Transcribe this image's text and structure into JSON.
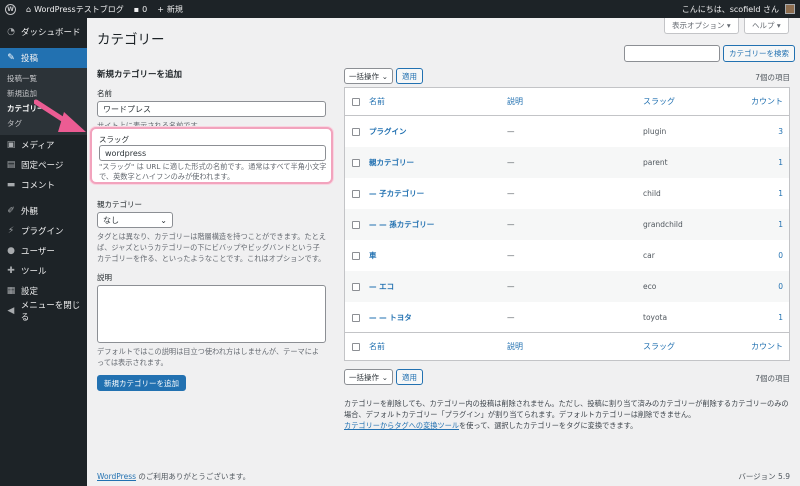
{
  "adminbar": {
    "site_name": "WordPressテストブログ",
    "comments_count": "0",
    "new_label": "新規",
    "greeting": "こんにちは、scofield さん"
  },
  "sidebar": {
    "items": [
      {
        "label": "ダッシュボード",
        "icon": "dashboard-icon"
      },
      {
        "label": "投稿",
        "icon": "pin-icon"
      },
      {
        "label": "メディア",
        "icon": "media-icon"
      },
      {
        "label": "固定ページ",
        "icon": "page-icon"
      },
      {
        "label": "コメント",
        "icon": "comment-icon"
      },
      {
        "label": "外観",
        "icon": "brush-icon"
      },
      {
        "label": "プラグイン",
        "icon": "plugin-icon"
      },
      {
        "label": "ユーザー",
        "icon": "user-icon"
      },
      {
        "label": "ツール",
        "icon": "wrench-icon"
      },
      {
        "label": "設定",
        "icon": "settings-icon"
      },
      {
        "label": "メニューを閉じる",
        "icon": "collapse-icon"
      }
    ],
    "submenu": [
      "投稿一覧",
      "新規追加",
      "カテゴリー",
      "タグ"
    ]
  },
  "top": {
    "screen_options": "表示オプション ▾",
    "help": "ヘルプ ▾"
  },
  "page_title": "カテゴリー",
  "search": {
    "button": "カテゴリーを検索",
    "value": ""
  },
  "form": {
    "heading": "新規カテゴリーを追加",
    "name_label": "名前",
    "name_value": "ワードプレス",
    "name_help": "サイト上に表示される名前です。",
    "slug_label": "スラッグ",
    "slug_value": "wordpress",
    "slug_help": "\"スラッグ\" は URL に適した形式の名前です。通常はすべて半角小文字で、英数字とハイフンのみが使われます。",
    "parent_label": "親カテゴリー",
    "parent_value": "なし",
    "parent_help": "タグとは異なり、カテゴリーは階層構造を持つことができます。たとえば、ジャズというカテゴリーの下にビバップやビッグバンドという子カテゴリーを作る、といったようなことです。これはオプションです。",
    "desc_label": "説明",
    "desc_help": "デフォルトではこの説明は目立つ使われ方はしませんが、テーマによっては表示されます。",
    "submit": "新規カテゴリーを追加"
  },
  "table": {
    "bulk_label": "一括操作",
    "apply": "適用",
    "count_text": "7個の項目",
    "headers": {
      "name": "名前",
      "desc": "説明",
      "slug": "スラッグ",
      "count": "カウント"
    },
    "rows": [
      {
        "name": "プラグイン",
        "desc": "—",
        "slug": "plugin",
        "count": "3"
      },
      {
        "name": "親カテゴリー",
        "desc": "—",
        "slug": "parent",
        "count": "1"
      },
      {
        "name": "— 子カテゴリー",
        "desc": "—",
        "slug": "child",
        "count": "1"
      },
      {
        "name": "— — 孫カテゴリー",
        "desc": "—",
        "slug": "grandchild",
        "count": "1"
      },
      {
        "name": "車",
        "desc": "—",
        "slug": "car",
        "count": "0"
      },
      {
        "name": "— エコ",
        "desc": "—",
        "slug": "eco",
        "count": "0"
      },
      {
        "name": "— — トヨタ",
        "desc": "—",
        "slug": "toyota",
        "count": "1"
      }
    ]
  },
  "notes": {
    "line1": "カテゴリーを削除しても、カテゴリー内の投稿は削除されません。ただし、投稿に割り当て済みのカテゴリーが削除するカテゴリーのみの場合、デフォルトカテゴリー「プラグイン」が割り当てられます。デフォルトカテゴリーは削除できません。",
    "link": "カテゴリーからタグへの変換ツール",
    "line2": "を使って、選択したカテゴリーをタグに変換できます。"
  },
  "footer": {
    "wp_link": "WordPress",
    "thanks": " のご利用ありがとうございます。",
    "version": "バージョン 5.9"
  },
  "colors": {
    "accent": "#2271b1",
    "admin_dark": "#1d2327",
    "highlight_border": "#f2a3bd",
    "arrow": "#ec5c93"
  }
}
